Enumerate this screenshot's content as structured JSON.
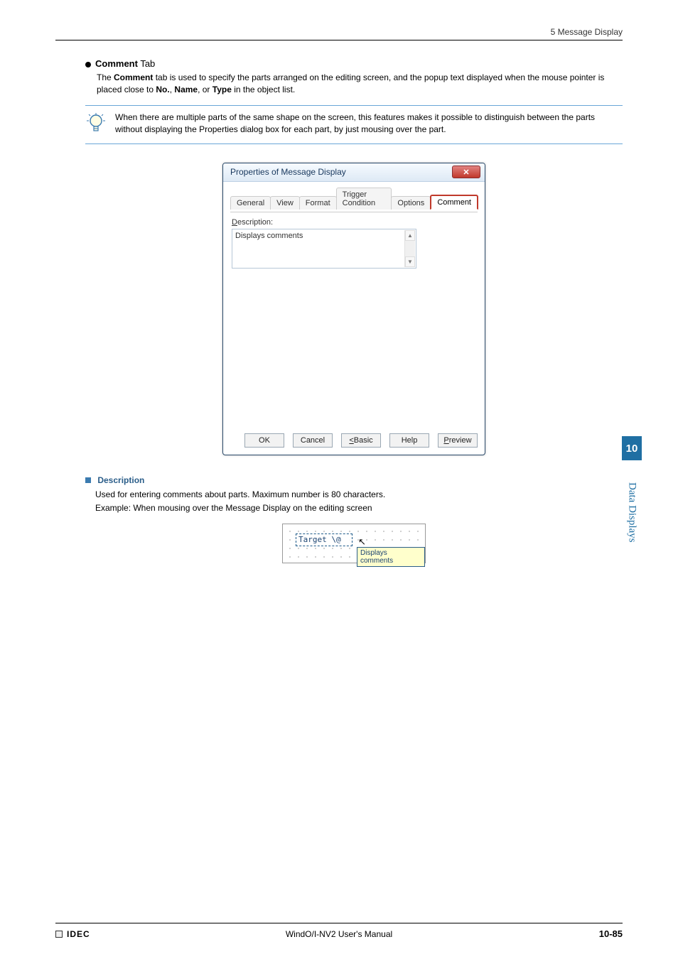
{
  "header": {
    "section": "5 Message Display"
  },
  "heading": {
    "bold": "Comment",
    "rest": " Tab"
  },
  "intro": {
    "line1a": "The ",
    "line1b": "Comment",
    "line1c": " tab is used to specify the parts arranged on the editing screen, and the popup text displayed when the mouse pointer is placed close to ",
    "kw1": "No.",
    "sep1": ", ",
    "kw2": "Name",
    "sep2": ", or ",
    "kw3": "Type",
    "line1d": " in the object list."
  },
  "tip": "When there are multiple parts of the same shape on the screen, this features makes it possible to distinguish between the parts without displaying the Properties dialog box for each part, by just mousing over the part.",
  "dialog": {
    "title": "Properties of Message Display",
    "tabs": {
      "general": "General",
      "view": "View",
      "format": "Format",
      "trigger": "Trigger Condition",
      "options": "Options",
      "comment": "Comment"
    },
    "descLabelPre": "D",
    "descLabelPost": "escription:",
    "descValue": "Displays comments",
    "buttons": {
      "ok": "OK",
      "cancel": "Cancel",
      "basicPre": "<",
      "basicPost": " Basic",
      "help": "Help",
      "previewPre": "P",
      "previewPost": "review"
    }
  },
  "desc": {
    "heading": "Description",
    "body1": "Used for entering comments about parts. Maximum number is 80 characters.",
    "body2": "Example: When mousing over the Message Display on the editing screen"
  },
  "example": {
    "widgetText": "Target   \\@",
    "tooltip": "Displays comments"
  },
  "side": {
    "num": "10",
    "label": "Data Displays"
  },
  "footer": {
    "brand": "IDEC",
    "center": "WindO/I-NV2 User's Manual",
    "right": "10-85"
  }
}
